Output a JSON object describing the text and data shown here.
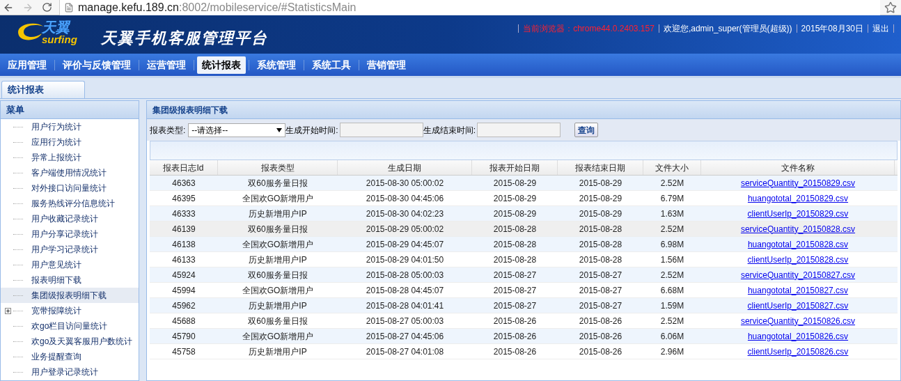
{
  "browser": {
    "url_host": "manage.kefu.189.cn",
    "url_path": ":8002/mobileservice/#StatisticsMain"
  },
  "header": {
    "logo_cn": "天翼",
    "logo_en": "surfing",
    "title": "天翼手机客服管理平台",
    "browser_info": "当前浏览器：chrome44.0.2403.157",
    "welcome": "欢迎您,admin_super(管理员(超级))",
    "date": "2015年08月30日",
    "logout": "退出"
  },
  "nav": [
    {
      "label": "应用管理",
      "selected": false
    },
    {
      "label": "评价与反馈管理",
      "selected": false
    },
    {
      "label": "运营管理",
      "selected": false
    },
    {
      "label": "统计报表",
      "selected": true
    },
    {
      "label": "系统管理",
      "selected": false
    },
    {
      "label": "系统工具",
      "selected": false
    },
    {
      "label": "营销管理",
      "selected": false
    }
  ],
  "tabs": [
    {
      "label": "统计报表",
      "selected": true
    }
  ],
  "sidebar": {
    "title": "菜单",
    "items": [
      {
        "label": "用户行为统计",
        "kind": "leaf",
        "selected": false
      },
      {
        "label": "应用行为统计",
        "kind": "leaf",
        "selected": false
      },
      {
        "label": "异常上报统计",
        "kind": "leaf",
        "selected": false
      },
      {
        "label": "客户端使用情况统计",
        "kind": "leaf",
        "selected": false
      },
      {
        "label": "对外接口访问量统计",
        "kind": "leaf",
        "selected": false
      },
      {
        "label": "服务热线评分信息统计",
        "kind": "leaf",
        "selected": false
      },
      {
        "label": "用户收藏记录统计",
        "kind": "leaf",
        "selected": false
      },
      {
        "label": "用户分享记录统计",
        "kind": "leaf",
        "selected": false
      },
      {
        "label": "用户学习记录统计",
        "kind": "leaf",
        "selected": false
      },
      {
        "label": "用户意见统计",
        "kind": "leaf",
        "selected": false
      },
      {
        "label": "报表明细下载",
        "kind": "leaf",
        "selected": false
      },
      {
        "label": "集团级报表明细下载",
        "kind": "leaf",
        "selected": true
      },
      {
        "label": "宽带报障统计",
        "kind": "folder",
        "selected": false
      },
      {
        "label": "欢go栏目访问量统计",
        "kind": "leaf",
        "selected": false
      },
      {
        "label": "欢go及天翼客服用户数统计",
        "kind": "leaf",
        "selected": false
      },
      {
        "label": "业务提醒查询",
        "kind": "leaf",
        "selected": false
      },
      {
        "label": "用户登录记录统计",
        "kind": "leaf",
        "selected": false
      }
    ]
  },
  "panel": {
    "title": "集团级报表明细下载",
    "filters": {
      "type_label": "报表类型:",
      "type_value": "--请选择--",
      "start_label": "生成开始时间:",
      "end_label": "生成结束时间:",
      "query_button": "查询"
    },
    "table": {
      "columns": [
        "报表日志Id",
        "报表类型",
        "生成日期",
        "报表开始日期",
        "报表结束日期",
        "文件大小",
        "文件名称"
      ],
      "rows": [
        {
          "cells": [
            "46363",
            "双60服务量日报",
            "2015-08-30 05:00:02",
            "2015-08-29",
            "2015-08-29",
            "2.52M",
            "serviceQuantity_20150829.csv"
          ],
          "hovered": false
        },
        {
          "cells": [
            "46395",
            "全国欢GO新增用户",
            "2015-08-30 04:45:06",
            "2015-08-29",
            "2015-08-29",
            "6.79M",
            "huangototal_20150829.csv"
          ],
          "hovered": false
        },
        {
          "cells": [
            "46333",
            "历史新增用户IP",
            "2015-08-30 04:02:23",
            "2015-08-29",
            "2015-08-29",
            "1.63M",
            "clientUserIp_20150829.csv"
          ],
          "hovered": false
        },
        {
          "cells": [
            "46139",
            "双60服务量日报",
            "2015-08-29 05:00:02",
            "2015-08-28",
            "2015-08-28",
            "2.52M",
            "serviceQuantity_20150828.csv"
          ],
          "hovered": true
        },
        {
          "cells": [
            "46138",
            "全国欢GO新增用户",
            "2015-08-29 04:45:07",
            "2015-08-28",
            "2015-08-28",
            "6.98M",
            "huangototal_20150828.csv"
          ],
          "hovered": false
        },
        {
          "cells": [
            "46133",
            "历史新增用户IP",
            "2015-08-29 04:01:50",
            "2015-08-28",
            "2015-08-28",
            "1.56M",
            "clientUserIp_20150828.csv"
          ],
          "hovered": false
        },
        {
          "cells": [
            "45924",
            "双60服务量日报",
            "2015-08-28 05:00:03",
            "2015-08-27",
            "2015-08-27",
            "2.52M",
            "serviceQuantity_20150827.csv"
          ],
          "hovered": false
        },
        {
          "cells": [
            "45994",
            "全国欢GO新增用户",
            "2015-08-28 04:45:07",
            "2015-08-27",
            "2015-08-27",
            "6.68M",
            "huangototal_20150827.csv"
          ],
          "hovered": false
        },
        {
          "cells": [
            "45962",
            "历史新增用户IP",
            "2015-08-28 04:01:41",
            "2015-08-27",
            "2015-08-27",
            "1.59M",
            "clientUserIp_20150827.csv"
          ],
          "hovered": false
        },
        {
          "cells": [
            "45688",
            "双60服务量日报",
            "2015-08-27 05:00:03",
            "2015-08-26",
            "2015-08-26",
            "2.52M",
            "serviceQuantity_20150826.csv"
          ],
          "hovered": false
        },
        {
          "cells": [
            "45790",
            "全国欢GO新增用户",
            "2015-08-27 04:45:06",
            "2015-08-26",
            "2015-08-26",
            "6.06M",
            "huangototal_20150826.csv"
          ],
          "hovered": false
        },
        {
          "cells": [
            "45758",
            "历史新增用户IP",
            "2015-08-27 04:01:08",
            "2015-08-26",
            "2015-08-26",
            "2.96M",
            "clientUserIp_20150826.csv"
          ],
          "hovered": false
        }
      ]
    }
  }
}
